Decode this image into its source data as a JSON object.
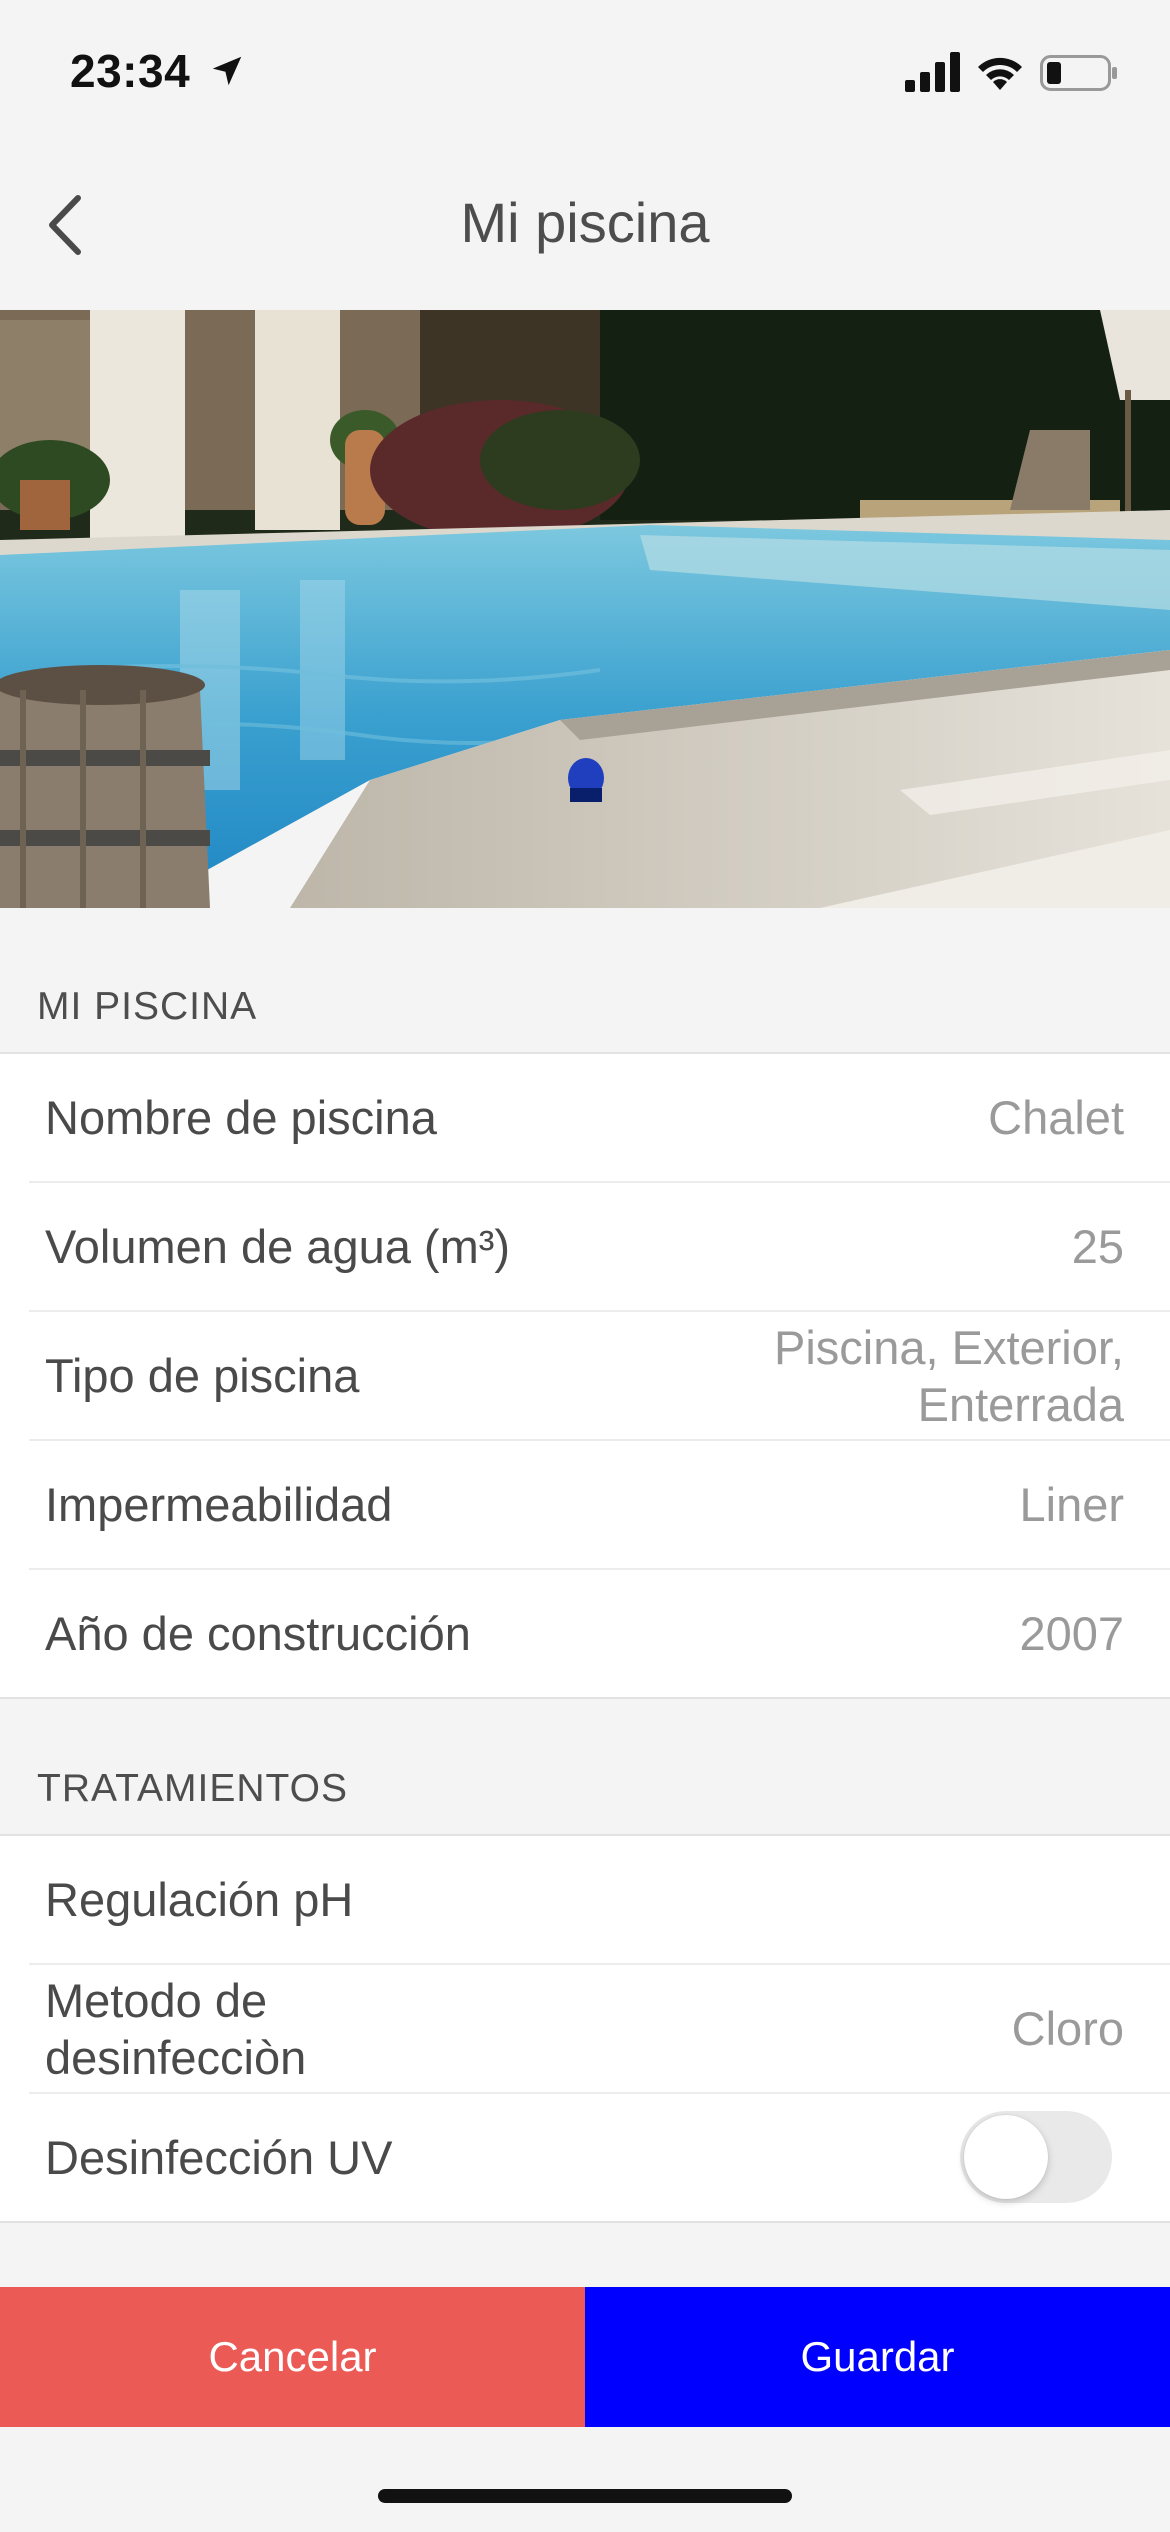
{
  "status_bar": {
    "time": "23:34",
    "icons": [
      "location-arrow-icon",
      "cellular-signal-icon",
      "wifi-icon",
      "battery-icon"
    ]
  },
  "nav": {
    "title": "Mi piscina",
    "back_icon": "chevron-left-icon"
  },
  "hero": {
    "image": "pool-photo"
  },
  "sections": {
    "pool": {
      "header": "MI PISCINA",
      "rows": [
        {
          "label": "Nombre de piscina",
          "value": "Chalet"
        },
        {
          "label": "Volumen de agua (m³)",
          "value": "25"
        },
        {
          "label": "Tipo de piscina",
          "value": "Piscina, Exterior, Enterrada"
        },
        {
          "label": "Impermeabilidad",
          "value": "Liner"
        },
        {
          "label": "Año de construcción",
          "value": "2007"
        }
      ]
    },
    "treatments": {
      "header": "TRATAMIENTOS",
      "rows": [
        {
          "label": "Regulación pH",
          "value": ""
        },
        {
          "label": "Metodo de desinfecciòn",
          "value": "Cloro"
        },
        {
          "label": "Desinfección UV",
          "toggle": false
        }
      ]
    }
  },
  "actions": {
    "cancel_label": "Cancelar",
    "save_label": "Guardar"
  },
  "colors": {
    "cancel": "#eb5a55",
    "save": "#0000ff",
    "background": "#f4f4f4"
  }
}
